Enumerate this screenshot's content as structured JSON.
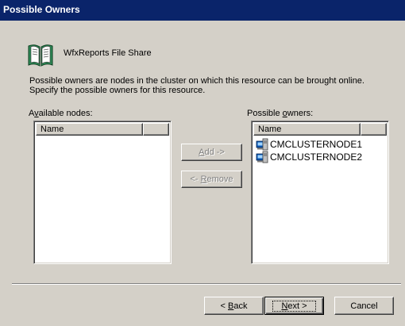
{
  "window": {
    "title": "Possible Owners"
  },
  "resource": {
    "name": "WfxReports File Share",
    "icon": "open-book-icon"
  },
  "description": {
    "line1": "Possible owners are nodes in the cluster on which this resource can be brought online.",
    "line2": "Specify the possible owners for this resource."
  },
  "available": {
    "label_pre": "A",
    "label_mnemonic": "v",
    "label_post": "ailable nodes:",
    "column": "Name",
    "items": []
  },
  "owners": {
    "label_pre": "Possible ",
    "label_mnemonic": "o",
    "label_post": "wners:",
    "column": "Name",
    "items": [
      "CMCLUSTERNODE1",
      "CMCLUSTERNODE2"
    ]
  },
  "buttons": {
    "add": {
      "mnemonic": "A",
      "rest": "dd ->"
    },
    "remove": {
      "pre": "<- ",
      "mnemonic": "R",
      "rest": "emove"
    },
    "back": {
      "pre": "< ",
      "mnemonic": "B",
      "rest": "ack"
    },
    "next": {
      "mnemonic": "N",
      "rest": "ext >"
    },
    "cancel": "Cancel"
  },
  "colors": {
    "titlebar": "#0a246a",
    "dialog": "#d4d0c8",
    "disabled_text": "#808080"
  }
}
